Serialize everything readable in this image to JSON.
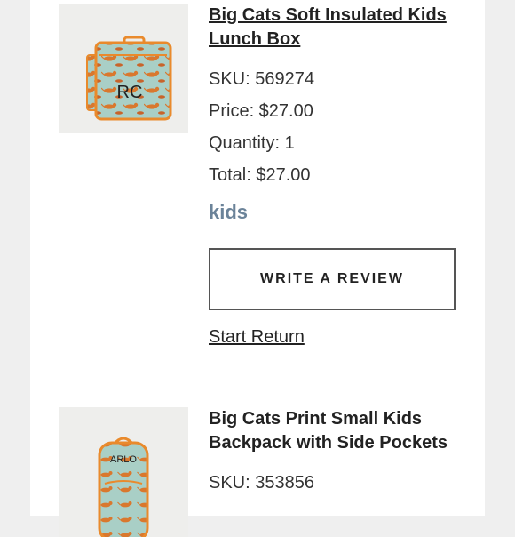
{
  "items": [
    {
      "title": "Big Cats Soft Insulated Kids Lunch Box",
      "sku": "SKU: 569274",
      "price": "Price: $27.00",
      "quantity": "Quantity: 1",
      "total": "Total: $27.00",
      "brand": "kids",
      "monogram": "RC",
      "review_button": "WRITE A REVIEW",
      "return_link": "Start Return"
    },
    {
      "title": "Big Cats Print Small Kids Backpack with Side Pockets",
      "sku": "SKU: 353856",
      "monogram": "ARLO"
    }
  ],
  "colors": {
    "brand": "#6b8399",
    "print_background": "#a9cfc6",
    "cat_orange": "#d9782e",
    "trim_orange": "#e98a2c"
  }
}
